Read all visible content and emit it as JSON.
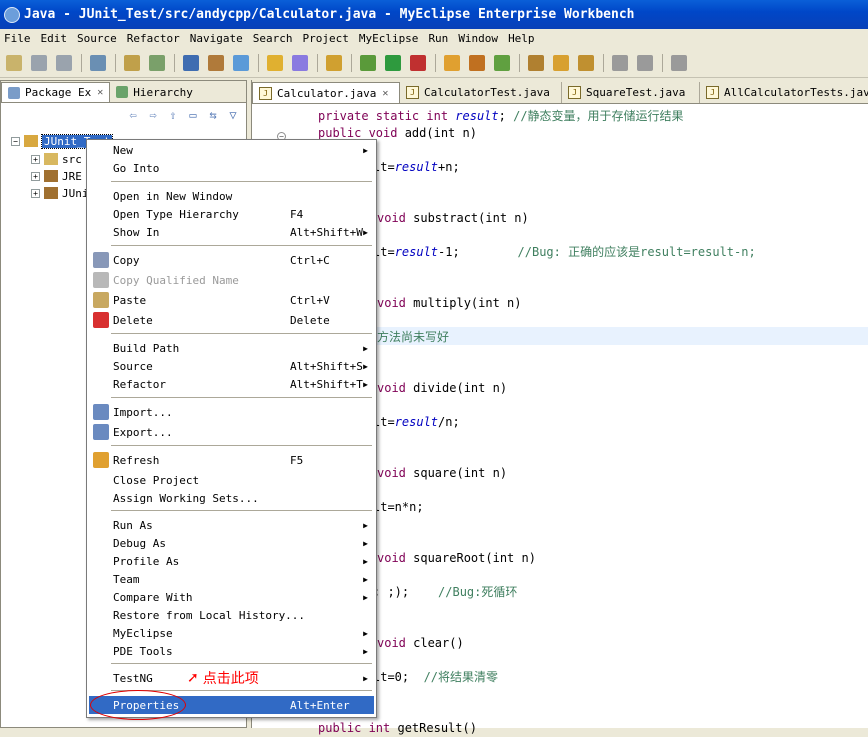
{
  "window": {
    "title": "Java - JUnit_Test/src/andycpp/Calculator.java - MyEclipse Enterprise Workbench"
  },
  "menubar": [
    "File",
    "Edit",
    "Source",
    "Refactor",
    "Navigate",
    "Search",
    "Project",
    "MyEclipse",
    "Run",
    "Window",
    "Help"
  ],
  "left_panel": {
    "tabs": [
      {
        "label": "Package Ex",
        "close": "✕"
      },
      {
        "label": "Hierarchy",
        "close": ""
      }
    ],
    "tree": [
      {
        "label": "JUnit_Test",
        "toggle": "−",
        "selected": true
      },
      {
        "label": "src",
        "toggle": "+",
        "selected": false
      },
      {
        "label": "JRE",
        "toggle": "+",
        "selected": false
      },
      {
        "label": "JUni",
        "toggle": "+",
        "selected": false
      }
    ]
  },
  "editor": {
    "tabs": [
      {
        "label": "Calculator.java",
        "close": "✕"
      },
      {
        "label": "CalculatorTest.java",
        "close": ""
      },
      {
        "label": "SquareTest.java",
        "close": ""
      },
      {
        "label": "AllCalculatorTests.java",
        "close": ""
      }
    ],
    "code": [
      {
        "parts": [
          [
            "kw",
            "private static int "
          ],
          [
            "fld",
            "result"
          ],
          [
            "",
            "; "
          ],
          [
            "cm",
            "//静态变量，用于存储运行结果"
          ]
        ]
      },
      {
        "parts": [
          [
            "kw",
            "public void "
          ],
          [
            "",
            "add(int n)"
          ]
        ]
      },
      {
        "parts": [
          [
            "",
            "lt="
          ],
          [
            "fld",
            "result"
          ],
          [
            "",
            "+n;"
          ]
        ]
      },
      {
        "parts": [
          [
            "kw",
            "void "
          ],
          [
            "",
            "substract(int n)"
          ]
        ]
      },
      {
        "parts": [
          [
            "",
            "lt="
          ],
          [
            "fld",
            "result"
          ],
          [
            "",
            "-1;        "
          ],
          [
            "cm",
            "//Bug: 正确的应该是result=result-n;"
          ]
        ]
      },
      {
        "parts": [
          [
            "kw",
            "void "
          ],
          [
            "",
            "multiply(int n)"
          ]
        ]
      },
      {
        "parts": [
          [
            "cm",
            "方法尚未写好"
          ]
        ]
      },
      {
        "parts": [
          [
            "kw",
            "void "
          ],
          [
            "",
            "divide(int n)"
          ]
        ]
      },
      {
        "parts": [
          [
            "",
            "lt="
          ],
          [
            "fld",
            "result"
          ],
          [
            "",
            "/n;"
          ]
        ]
      },
      {
        "parts": [
          [
            "kw",
            "void "
          ],
          [
            "",
            "square(int n)"
          ]
        ]
      },
      {
        "parts": [
          [
            "",
            "lt=n*n;"
          ]
        ]
      },
      {
        "parts": [
          [
            "kw",
            "void "
          ],
          [
            "",
            "squareRoot(int n)"
          ]
        ]
      },
      {
        "parts": [
          [
            "",
            "; ;);    "
          ],
          [
            "cm",
            "//Bug:死循环"
          ]
        ]
      },
      {
        "parts": [
          [
            "kw",
            "void "
          ],
          [
            "",
            "clear()"
          ]
        ]
      },
      {
        "parts": [
          [
            "",
            "lt=0;  "
          ],
          [
            "cm",
            "//将结果清零"
          ]
        ]
      },
      {
        "parts": [
          [
            "kw",
            "public int "
          ],
          [
            "",
            "getResult()"
          ]
        ]
      }
    ]
  },
  "context_menu": {
    "items": [
      {
        "label": "New",
        "shortcut": "",
        "submenu": true
      },
      {
        "label": "Go Into",
        "shortcut": "",
        "submenu": false
      },
      {
        "label": "Open in New Window",
        "shortcut": "",
        "submenu": false
      },
      {
        "label": "Open Type Hierarchy",
        "shortcut": "F4",
        "submenu": false
      },
      {
        "label": "Show In",
        "shortcut": "Alt+Shift+W",
        "submenu": true
      },
      {
        "label": "Copy",
        "shortcut": "Ctrl+C",
        "submenu": false
      },
      {
        "label": "Copy Qualified Name",
        "shortcut": "",
        "submenu": false,
        "disabled": true
      },
      {
        "label": "Paste",
        "shortcut": "Ctrl+V",
        "submenu": false
      },
      {
        "label": "Delete",
        "shortcut": "Delete",
        "submenu": false
      },
      {
        "label": "Build Path",
        "shortcut": "",
        "submenu": true
      },
      {
        "label": "Source",
        "shortcut": "Alt+Shift+S",
        "submenu": true
      },
      {
        "label": "Refactor",
        "shortcut": "Alt+Shift+T",
        "submenu": true
      },
      {
        "label": "Import...",
        "shortcut": "",
        "submenu": false
      },
      {
        "label": "Export...",
        "shortcut": "",
        "submenu": false
      },
      {
        "label": "Refresh",
        "shortcut": "F5",
        "submenu": false
      },
      {
        "label": "Close Project",
        "shortcut": "",
        "submenu": false
      },
      {
        "label": "Assign Working Sets...",
        "shortcut": "",
        "submenu": false
      },
      {
        "label": "Run As",
        "shortcut": "",
        "submenu": true
      },
      {
        "label": "Debug As",
        "shortcut": "",
        "submenu": true
      },
      {
        "label": "Profile As",
        "shortcut": "",
        "submenu": true
      },
      {
        "label": "Team",
        "shortcut": "",
        "submenu": true
      },
      {
        "label": "Compare With",
        "shortcut": "",
        "submenu": true
      },
      {
        "label": "Restore from Local History...",
        "shortcut": "",
        "submenu": false
      },
      {
        "label": "MyEclipse",
        "shortcut": "",
        "submenu": true
      },
      {
        "label": "PDE Tools",
        "shortcut": "",
        "submenu": true
      },
      {
        "label": "TestNG",
        "shortcut": "",
        "submenu": true
      },
      {
        "label": "Properties",
        "shortcut": "Alt+Enter",
        "submenu": false,
        "highlighted": true
      }
    ],
    "submenu_arrow": "▶"
  },
  "annotation": {
    "text": "点击此项",
    "arrow": "➚"
  },
  "colors": {
    "title_bar": "#0a5fd8",
    "selection": "#316ac5",
    "annotation": "#ff0000"
  }
}
